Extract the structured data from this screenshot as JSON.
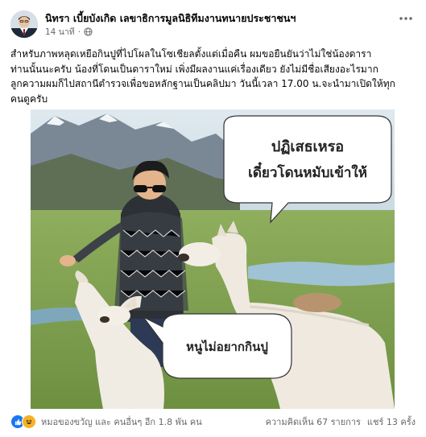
{
  "post": {
    "author": "นิทรา เบี้ยบังเกิด เลขาธิการมูลนิธิทีมงานทนายประชาชนฯ",
    "time": "14 นาที",
    "privacy_icon": "globe-icon",
    "more_icon": "more-options-icon",
    "text_lines": [
      "สำหรับภาพหลุดเหยือกินปูที่ไปโผลในโซเชียลตั้งแต่เมื่อคืน ผมขอยืนยันว่าไม่ใช่น้องดารา",
      "ท่านนั้นนะครับ น้องที่โดนเป็นดาราใหม่ เพิ่งมีผลงานแค่เรื่องเดียว ยังไม่มีชื่อเสียงอะไรมาก",
      "ลูกความผมก็ไปสถานีตำรวจเพื่อขอหลักฐานเป็นคลิปมา วันนี้เวลา 17.00 น.จะนำมาเปิดให้ทุก",
      "คนดูครับ"
    ]
  },
  "image": {
    "bubble_top_line1": "ปฏิเสธเหรอ",
    "bubble_top_line2": "เดี๋ยวโดนหมับเข้าให้",
    "bubble_bottom": "หนูไม่อยากกินปู"
  },
  "footer": {
    "reactions_text": "หมอของขวัญ และ คนอื่นๆ อีก 1.8 พัน คน",
    "comments": "ความคิดเห็น 67 รายการ",
    "shares": "แชร์ 13 ครั้ง"
  },
  "colors": {
    "like_blue": "#1877f2",
    "haha_yellow": "#f7b125",
    "meta_gray": "#65676b"
  }
}
